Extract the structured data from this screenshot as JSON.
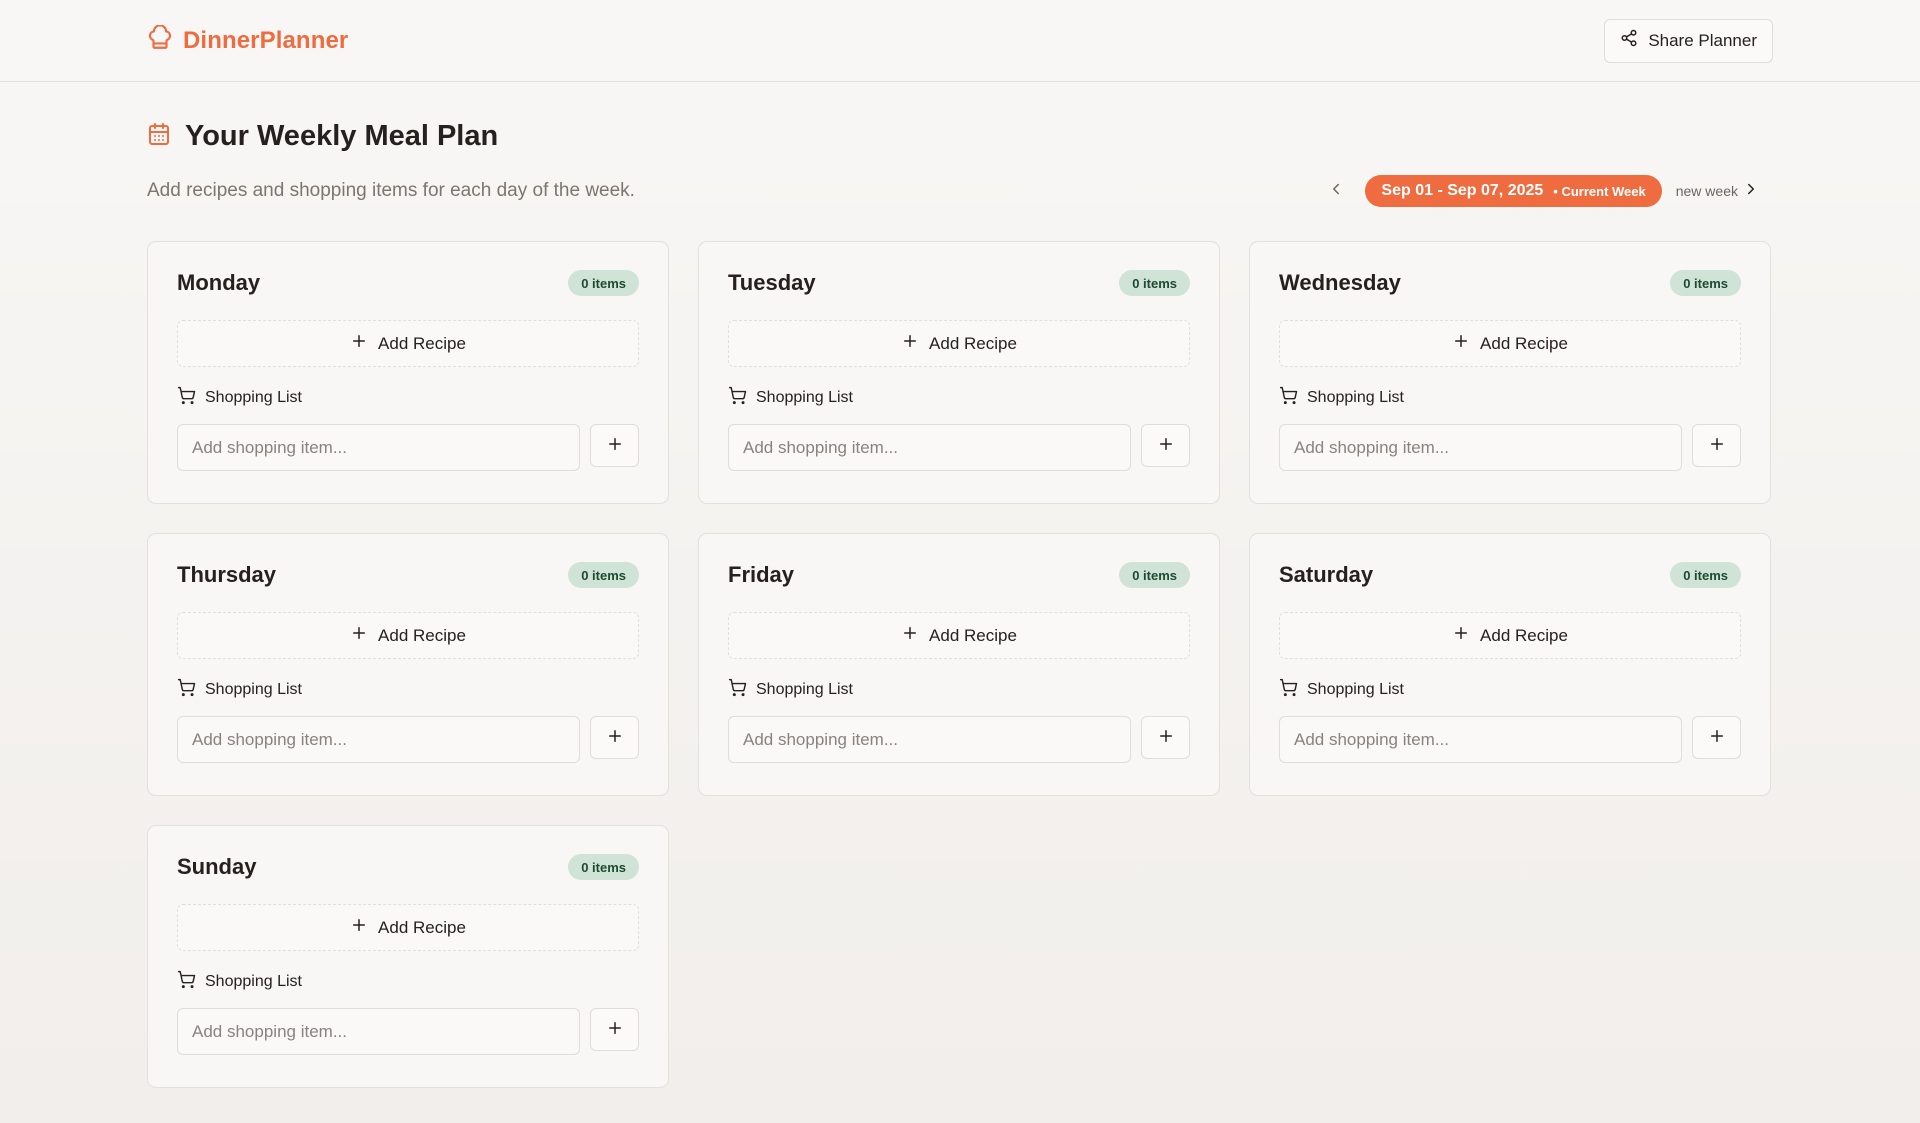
{
  "app": {
    "name": "DinnerPlanner"
  },
  "header": {
    "share_label": "Share Planner"
  },
  "page": {
    "title": "Your Weekly Meal Plan",
    "subtitle": "Add recipes and shopping items for each day of the week."
  },
  "week": {
    "range": "Sep 01 - Sep 07, 2025",
    "current_label": "• Current Week",
    "new_week_label": "new week"
  },
  "labels": {
    "add_recipe": "Add Recipe",
    "shopping_list": "Shopping List",
    "shopping_placeholder": "Add shopping item..."
  },
  "days": [
    {
      "name": "Monday",
      "badge": "0 items"
    },
    {
      "name": "Tuesday",
      "badge": "0 items"
    },
    {
      "name": "Wednesday",
      "badge": "0 items"
    },
    {
      "name": "Thursday",
      "badge": "0 items"
    },
    {
      "name": "Friday",
      "badge": "0 items"
    },
    {
      "name": "Saturday",
      "badge": "0 items"
    },
    {
      "name": "Sunday",
      "badge": "0 items"
    }
  ],
  "colors": {
    "accent": "#ee6c3f",
    "badge_bg": "#cfe3d6",
    "badge_text": "#1f4a32",
    "text": "#26211f",
    "muted": "#7d7570"
  },
  "icons": {
    "brand": "chef-hat-icon",
    "share": "share-icon",
    "calendar": "calendar-icon",
    "prev": "chevron-left-icon",
    "next": "chevron-right-icon",
    "plus": "plus-icon",
    "cart": "shopping-cart-icon"
  }
}
